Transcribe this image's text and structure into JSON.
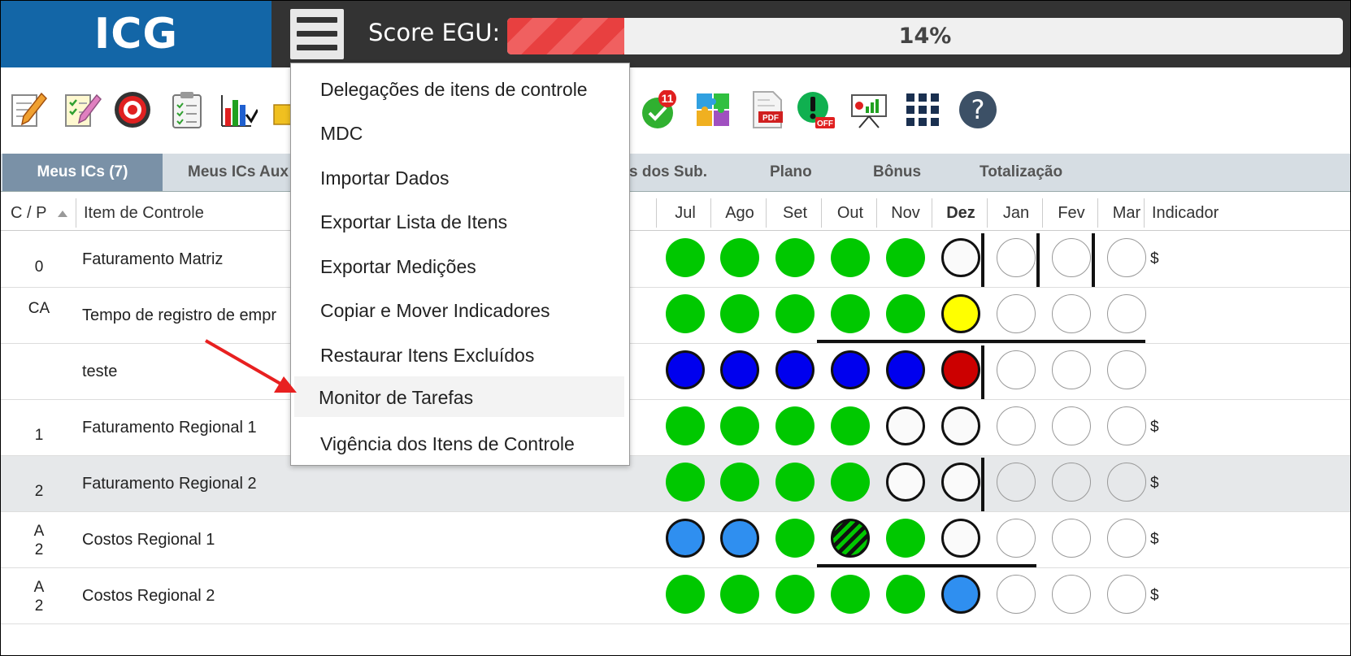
{
  "app": {
    "logo": "ICG"
  },
  "score": {
    "label": "Score EGU:",
    "percent": 14,
    "text": "14%"
  },
  "toolbar": {
    "badge_count": "11",
    "help_glyph": "?"
  },
  "tabs": [
    "Meus ICs (7)",
    "Meus ICs Aux",
    "s dos Sub.",
    "Plano",
    "Bônus",
    "Totalização"
  ],
  "table": {
    "col_cp": "C / P",
    "col_item": "Item de Controle",
    "months": [
      "Jul",
      "Ago",
      "Set",
      "Out",
      "Nov",
      "Dez",
      "Jan",
      "Fev",
      "Mar"
    ],
    "current_month": "Dez",
    "col_indicator": "Indicador",
    "rows": [
      {
        "cp1": "",
        "cp2": "0",
        "item": "Faturamento Matriz",
        "ind": "$"
      },
      {
        "cp1": "CA",
        "cp2": "",
        "item": "Tempo de registro de empr",
        "ind": ""
      },
      {
        "cp1": "",
        "cp2": "",
        "item": "teste",
        "ind": ""
      },
      {
        "cp1": "",
        "cp2": "1",
        "item": "Faturamento Regional 1",
        "ind": "$"
      },
      {
        "cp1": "",
        "cp2": "2",
        "item": "Faturamento Regional 2",
        "ind": "$"
      },
      {
        "cp1": "A",
        "cp2": "2",
        "item": "Costos Regional 1",
        "ind": "$"
      },
      {
        "cp1": "A",
        "cp2": "2",
        "item": "Costos Regional 2",
        "ind": "$"
      }
    ]
  },
  "menu": {
    "items": [
      "Delegações de itens de controle",
      "MDC",
      "Importar Dados",
      "Exportar Lista de Itens",
      "Exportar Medições",
      "Copiar e Mover Indicadores",
      "Restaurar Itens Excluídos",
      "Monitor de Tarefas",
      "Vigência dos Itens de Controle"
    ],
    "highlighted": "Monitor de Tarefas"
  },
  "colors": {
    "green": "#00c800",
    "blue": "#0000ee",
    "light_blue": "#2f8ff0",
    "yellow": "#ffff00",
    "red": "#cc0000",
    "arrow": "#e82020",
    "logo_bg": "#1366a7"
  }
}
